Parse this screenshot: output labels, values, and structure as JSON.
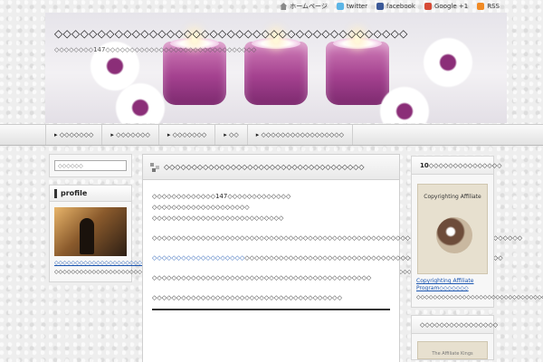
{
  "topbar": {
    "home_label": "ホームページ",
    "twitter_label": "twitter",
    "facebook_label": "facebook",
    "google_label": "Google +1",
    "rss_label": "RSS"
  },
  "header": {
    "site_title": "◇◇◇◇◇◇◇◇◇◇◇◇◇◇◇◇◇◇◇◇◇◇◇◇◇◇◇◇◇◇◇◇◇◇◇◇◇◇◇◇◇",
    "site_description": "◇◇◇◇◇◇◇◇147◇◇◇◇◇◇◇◇◇◇◇◇◇◇◇◇◇◇◇◇◇◇◇◇◇◇◇◇◇◇◇"
  },
  "nav": {
    "items": [
      "▸ ◇◇◇◇◇◇◇",
      "▸ ◇◇◇◇◇◇◇",
      "▸ ◇◇◇◇◇◇◇",
      "▸ ◇◇",
      "▸ ◇◇◇◇◇◇◇◇◇◇◇◇◇◇◇◇◇"
    ]
  },
  "left_sidebar": {
    "search_placeholder": "◇◇◇◇◇◇",
    "profile_heading": "profile",
    "profile_link": "◇◇◇◇◇◇◇◇◇◇◇◇◇◇◇◇◇◇◇◇◇◇◇◇◇◇◇◇◇◇◇◇◇◇",
    "profile_text": "◇◇◇◇◇◇◇◇◇◇◇◇◇◇◇◇◇◇◇◇◇◇◇◇◇◇◇147◇◇◇◇◇◇◇◇◇◇◇◇◇◇◇◇◇◇◇◇◇◇◇◇◇◇◇◇◇◇◇◇◇◇◇◇◇◇◇◇◇◇◇◇◇◇◇◇◇◇◇◇◇◇◇◇◇◇◇◇"
  },
  "post": {
    "title": "◇◇◇◇◇◇◇◇◇◇◇◇◇◇◇◇◇◇◇◇◇◇◇◇◇◇◇◇◇◇◇◇◇◇◇◇",
    "line1": "◇◇◇◇◇◇◇◇◇◇◇◇◇147◇◇◇◇◇◇◇◇◇◇◇◇◇",
    "line2": "◇◇◇◇◇◇◇◇◇◇◇◇◇◇◇◇◇◇◇◇",
    "line3": "◇◇◇◇◇◇◇◇◇◇◇◇◇◇◇◇◇◇◇◇◇◇◇◇◇◇◇",
    "para1": "◇◇◇◇◇◇◇◇◇◇◇◇◇◇◇◇◇◇◇◇◇◇◇◇◇◇◇◇◇◇◇◇◇◇◇◇◇◇◇◇◇◇◇◇◇◇◇◇◇◇◇◇◇◇◇◇◇◇◇◇◇◇◇◇◇◇◇◇◇◇◇◇◇◇◇◇",
    "para2_link": "◇◇◇◇◇◇◇◇◇◇◇◇◇◇◇◇◇◇◇",
    "para2_rest": "◇◇◇◇◇◇◇◇◇◇◇◇◇◇◇◇◇◇◇◇◇◇◇◇◇◇◇◇◇◇◇◇◇◇◇◇◇◇◇◇◇◇◇◇◇◇◇◇◇◇◇◇◇",
    "para3": "◇◇◇◇◇◇◇◇◇◇◇◇◇◇◇◇◇◇◇◇◇◇◇◇◇◇◇◇◇◇◇◇◇◇◇◇◇◇◇◇◇◇◇◇◇",
    "para4": "◇◇◇◇◇◇◇◇◇◇◇◇◇◇◇◇◇◇◇◇◇◇◇◇◇◇◇◇◇◇◇◇◇◇◇◇◇◇◇"
  },
  "right_sidebar": {
    "widget1_heading": "10◇◇◇◇◇◇◇◇◇◇◇◇◇◇◇",
    "book_cover_title": "Copyrighting Affiliate",
    "book_link": "Copyrighting Affiliate Program◇◇◇◇◇◇◇",
    "book_desc": "◇◇◇◇◇◇◇◇◇◇◇◇◇◇◇◇◇◇◇◇◇◇◇◇◇◇◇◇◇◇◇◇◇◇",
    "widget2_heading": "◇◇◇◇◇◇◇◇◇◇◇◇◇◇◇◇",
    "book2_cover_title": "The Affiliate Kings"
  }
}
